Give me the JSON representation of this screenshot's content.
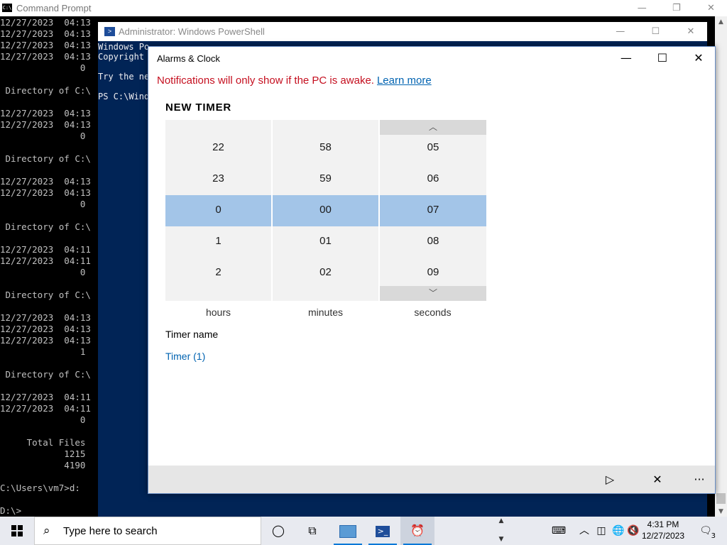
{
  "cmd": {
    "title": "Command Prompt",
    "icon_text": "C:\\",
    "lines": [
      "12/27/2023  04:13",
      "12/27/2023  04:13",
      "12/27/2023  04:13",
      "12/27/2023  04:13",
      "               0",
      "",
      " Directory of C:\\",
      "",
      "12/27/2023  04:13",
      "12/27/2023  04:13",
      "               0",
      "",
      " Directory of C:\\",
      "",
      "12/27/2023  04:13",
      "12/27/2023  04:13",
      "               0",
      "",
      " Directory of C:\\",
      "",
      "12/27/2023  04:11",
      "12/27/2023  04:11",
      "               0",
      "",
      " Directory of C:\\",
      "",
      "12/27/2023  04:13",
      "12/27/2023  04:13",
      "12/27/2023  04:13",
      "               1",
      "",
      " Directory of C:\\",
      "",
      "12/27/2023  04:11",
      "12/27/2023  04:11",
      "               0",
      "",
      "     Total Files",
      "            1215",
      "            4190",
      "",
      "C:\\Users\\vm7>d:",
      "",
      "D:\\>"
    ],
    "controls": {
      "minimize": "—",
      "maximize": "❐",
      "close": "✕"
    }
  },
  "powershell": {
    "title": "Administrator: Windows PowerShell",
    "lines": [
      "Windows Po",
      "Copyright",
      "",
      "Try the ne",
      "",
      "PS C:\\Wind"
    ],
    "controls": {
      "minimize": "—",
      "maximize": "☐",
      "close": "✕"
    }
  },
  "alarms": {
    "title": "Alarms & Clock",
    "controls": {
      "minimize": "—",
      "maximize": "☐",
      "close": "✕"
    },
    "notification": "Notifications will only show if the PC is awake.",
    "learn_more": "Learn more",
    "heading": "NEW TIMER",
    "hours": [
      "22",
      "23",
      "0",
      "1",
      "2"
    ],
    "minutes": [
      "58",
      "59",
      "00",
      "01",
      "02"
    ],
    "seconds": [
      "05",
      "06",
      "07",
      "08",
      "09"
    ],
    "selected": {
      "hours": "0",
      "minutes": "00",
      "seconds": "07"
    },
    "units": {
      "hours": "hours",
      "minutes": "minutes",
      "seconds": "seconds"
    },
    "timer_name_label": "Timer name",
    "timer_name_value": "Timer (1)",
    "commands": {
      "start": "▷",
      "cancel": "✕",
      "more": "···"
    }
  },
  "taskbar": {
    "search_placeholder": "Type here to search",
    "time": "4:31 PM",
    "date": "12/27/2023",
    "notification_count": "3",
    "apps": [
      "cortana-icon",
      "task-view-icon",
      "server-manager-icon",
      "powershell-icon",
      "alarms-clock-icon"
    ]
  }
}
